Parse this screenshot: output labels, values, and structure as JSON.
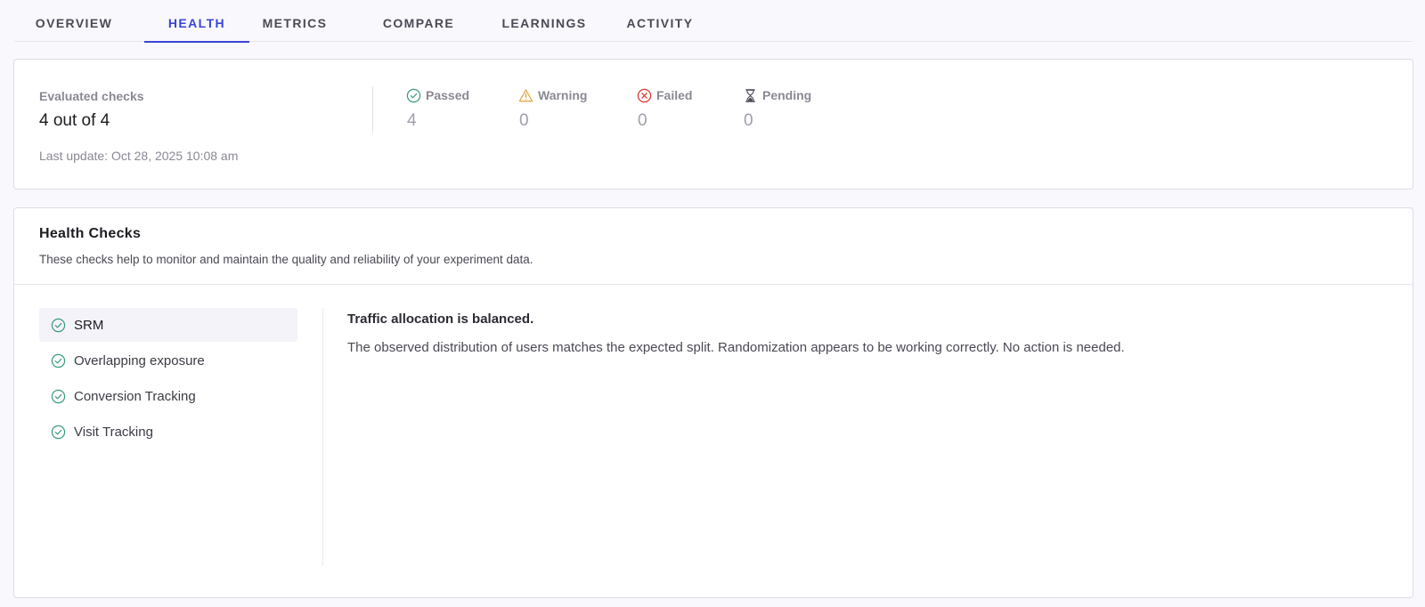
{
  "tabs": [
    {
      "label": "OVERVIEW",
      "active": false
    },
    {
      "label": "HEALTH",
      "active": true
    },
    {
      "label": "METRICS",
      "active": false
    },
    {
      "label": "COMPARE",
      "active": false
    },
    {
      "label": "LEARNINGS",
      "active": false
    },
    {
      "label": "ACTIVITY",
      "active": false
    }
  ],
  "summary": {
    "evaluated_label": "Evaluated checks",
    "evaluated_value": "4 out of 4",
    "last_update": "Last update: Oct 28, 2025 10:08 am",
    "stats": [
      {
        "label": "Passed",
        "value": "4",
        "icon": "check-circle-icon",
        "color": "#3a9b7e"
      },
      {
        "label": "Warning",
        "value": "0",
        "icon": "warning-icon",
        "color": "#e0a43a"
      },
      {
        "label": "Failed",
        "value": "0",
        "icon": "x-circle-icon",
        "color": "#d9352b"
      },
      {
        "label": "Pending",
        "value": "0",
        "icon": "hourglass-icon",
        "color": "#4a4a55"
      }
    ]
  },
  "checks": {
    "title": "Health Checks",
    "description": "These checks help to monitor and maintain the quality and reliability of your experiment data.",
    "items": [
      {
        "label": "SRM",
        "status": "passed",
        "selected": true
      },
      {
        "label": "Overlapping exposure",
        "status": "passed",
        "selected": false
      },
      {
        "label": "Conversion Tracking",
        "status": "passed",
        "selected": false
      },
      {
        "label": "Visit Tracking",
        "status": "passed",
        "selected": false
      }
    ],
    "detail": {
      "title": "Traffic allocation is balanced.",
      "body": "The observed distribution of users matches the expected split. Randomization appears to be working correctly. No action is needed."
    }
  },
  "colors": {
    "accent": "#3a45d6",
    "passed": "#3a9b7e"
  }
}
